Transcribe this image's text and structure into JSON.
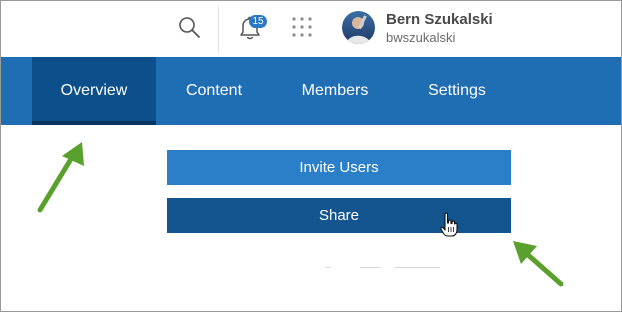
{
  "header": {
    "notification_count": "15",
    "user": {
      "name": "Bern Szukalski",
      "username": "bwszukalski"
    },
    "icons": [
      "search-icon",
      "bell-icon",
      "apps-grid-icon",
      "avatar"
    ]
  },
  "nav": {
    "tabs": [
      {
        "label": "Overview",
        "active": true
      },
      {
        "label": "Content",
        "active": false
      },
      {
        "label": "Members",
        "active": false
      },
      {
        "label": "Settings",
        "active": false
      }
    ]
  },
  "actions": {
    "invite_label": "Invite Users",
    "share_label": "Share"
  },
  "annotations": {
    "arrow_color": "#5aa02c"
  },
  "colors": {
    "nav_bg": "#1f6db3",
    "nav_active": "#0d4f8a",
    "invite_bg": "#2b7ec8",
    "share_bg": "#14558f",
    "badge": "#2b78c4"
  }
}
